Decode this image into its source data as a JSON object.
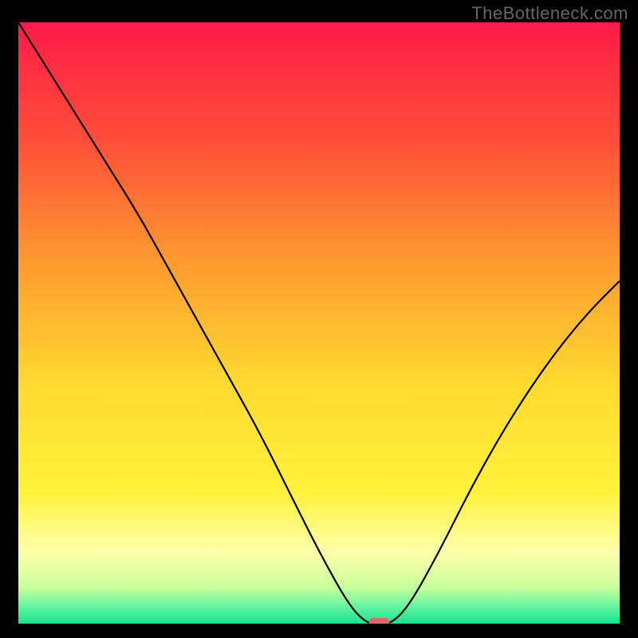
{
  "watermark": "TheBottleneck.com",
  "chart_data": {
    "type": "line",
    "title": "",
    "xlabel": "",
    "ylabel": "",
    "xlim": [
      0,
      100
    ],
    "ylim": [
      0,
      100
    ],
    "x": [
      0,
      5,
      10,
      15,
      20,
      25,
      30,
      35,
      40,
      45,
      50,
      55,
      58,
      60,
      62,
      65,
      70,
      75,
      80,
      85,
      90,
      95,
      100
    ],
    "values": [
      100,
      92,
      84,
      76,
      68,
      59,
      50,
      41,
      32,
      22,
      12,
      3,
      0,
      0,
      0,
      3,
      12,
      22,
      31,
      39,
      46,
      52,
      57
    ],
    "marker": {
      "x": 60,
      "y": 0
    },
    "background": {
      "type": "vertical_gradient",
      "stops": [
        {
          "pos": 0.0,
          "color": "#ff1a48"
        },
        {
          "pos": 0.2,
          "color": "#ff4f3a"
        },
        {
          "pos": 0.4,
          "color": "#ff9b2f"
        },
        {
          "pos": 0.6,
          "color": "#ffd930"
        },
        {
          "pos": 0.78,
          "color": "#fff23a"
        },
        {
          "pos": 0.88,
          "color": "#ffffaa"
        },
        {
          "pos": 0.94,
          "color": "#c8ff9c"
        },
        {
          "pos": 0.975,
          "color": "#5bf3a0"
        },
        {
          "pos": 1.0,
          "color": "#18e38c"
        }
      ]
    },
    "line_color": "#000000",
    "marker_color": "#d86a6a"
  }
}
